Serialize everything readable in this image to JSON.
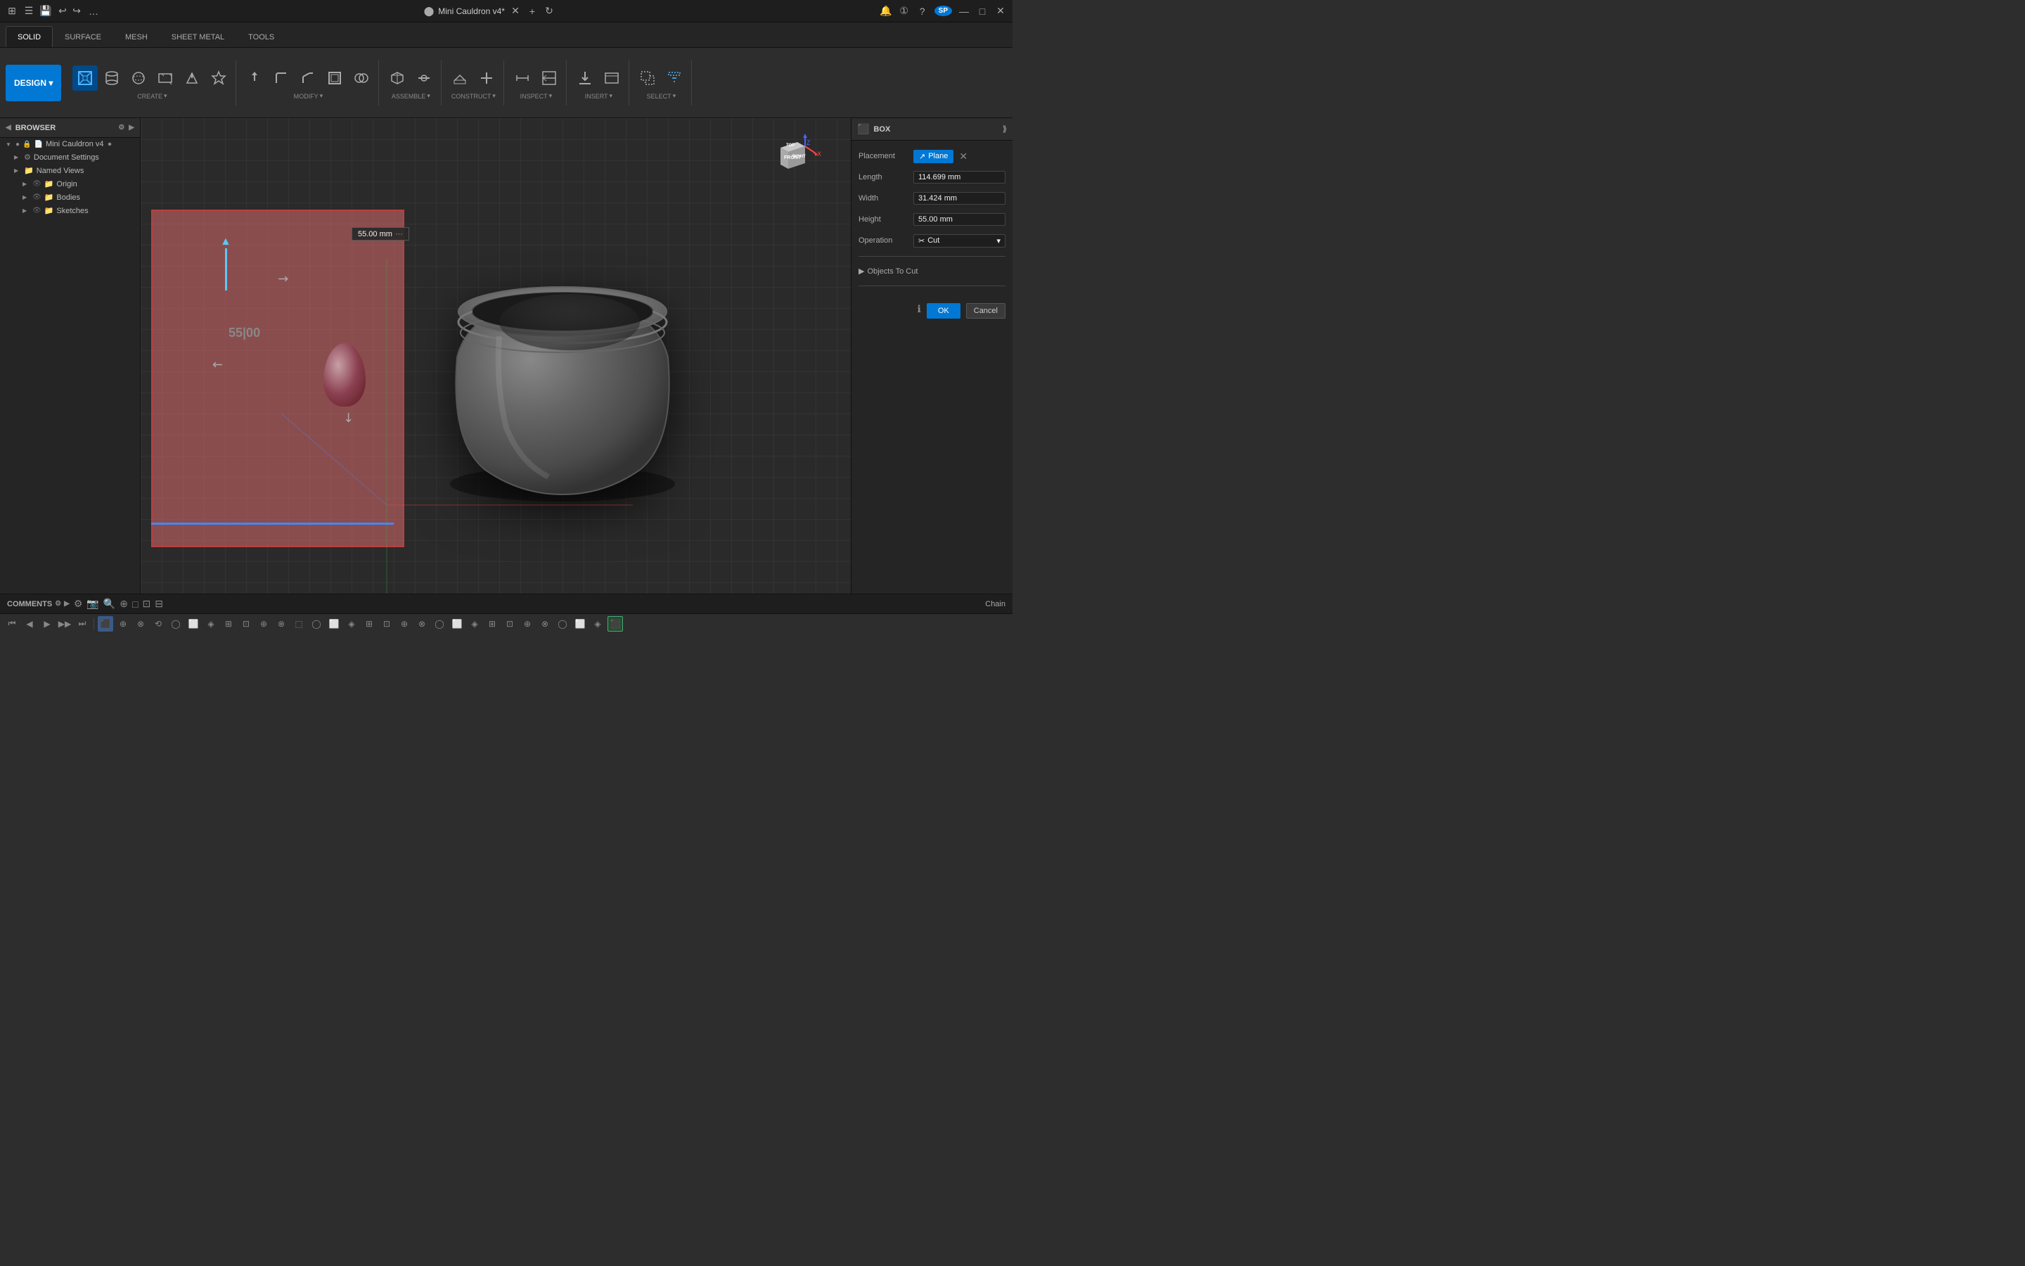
{
  "app": {
    "title": "Mini Cauldron v4*",
    "title_icon": "●"
  },
  "titlebar": {
    "logo": "⊞",
    "menu_icon": "☰",
    "save_icon": "💾",
    "undo_icon": "↩",
    "redo_icon": "↪",
    "more_icon": "…",
    "notification_label": "🔔",
    "help_icon": "?",
    "profile_label": "SP",
    "close_icon": "✕",
    "minimize_icon": "—",
    "maximize_icon": "□",
    "refresh_icon": "↻",
    "add_tab_icon": "+"
  },
  "ribbon_tabs": {
    "items": [
      {
        "id": "solid",
        "label": "SOLID",
        "active": true
      },
      {
        "id": "surface",
        "label": "SURFACE",
        "active": false
      },
      {
        "id": "mesh",
        "label": "MESH",
        "active": false
      },
      {
        "id": "sheet_metal",
        "label": "SHEET METAL",
        "active": false
      },
      {
        "id": "tools",
        "label": "TOOLS",
        "active": false
      }
    ]
  },
  "ribbon": {
    "design_btn": "DESIGN ▾",
    "groups": {
      "create": {
        "label": "CREATE",
        "label_arrow": "▾",
        "icons": [
          "⬛",
          "📦",
          "⭕",
          "⬜",
          "📐",
          "✦"
        ]
      },
      "modify": {
        "label": "MODIFY",
        "label_arrow": "▾",
        "icons": [
          "⟳",
          "✂",
          "📏",
          "🔄",
          "⟵"
        ]
      },
      "assemble": {
        "label": "ASSEMBLE",
        "label_arrow": "▾",
        "icons": [
          "⊕",
          "⊗"
        ]
      },
      "construct": {
        "label": "CONSTRUCT",
        "label_arrow": "▾",
        "icons": [
          "▦",
          "⟂"
        ]
      },
      "inspect": {
        "label": "INSPECT",
        "label_arrow": "▾",
        "icons": [
          "↔",
          "📷"
        ]
      },
      "insert": {
        "label": "INSERT",
        "label_arrow": "▾",
        "icons": [
          "⬇",
          "🖼"
        ]
      },
      "select": {
        "label": "SELECT",
        "label_arrow": "▾",
        "icons": [
          "⬚",
          "⟡"
        ]
      }
    }
  },
  "browser": {
    "title": "BROWSER",
    "items": [
      {
        "id": "root",
        "label": "Mini Cauldron v4",
        "level": 0,
        "expanded": true,
        "has_arrow": true,
        "icon": "📄"
      },
      {
        "id": "doc_settings",
        "label": "Document Settings",
        "level": 1,
        "expanded": false,
        "has_arrow": true,
        "icon": "⚙"
      },
      {
        "id": "named_views",
        "label": "Named Views",
        "level": 1,
        "expanded": false,
        "has_arrow": true,
        "icon": "📁"
      },
      {
        "id": "origin",
        "label": "Origin",
        "level": 2,
        "expanded": false,
        "has_arrow": true,
        "icon": "📁"
      },
      {
        "id": "bodies",
        "label": "Bodies",
        "level": 2,
        "expanded": false,
        "has_arrow": true,
        "icon": "📁"
      },
      {
        "id": "sketches",
        "label": "Sketches",
        "level": 2,
        "expanded": false,
        "has_arrow": true,
        "icon": "📁"
      }
    ]
  },
  "viewport": {
    "dimension_value": "55.00 mm",
    "height_label": "55|00",
    "axis_colors": {
      "x": "#ff4444",
      "y": "#44ff44",
      "z": "#4488ff"
    }
  },
  "properties": {
    "title": "BOX",
    "title_icon": "⬛",
    "expand_icon": "⟫",
    "placement_label": "Placement",
    "placement_btn": "Plane",
    "placement_plane_icon": "↗",
    "placement_x": "✕",
    "length_label": "Length",
    "length_value": "114.699 mm",
    "width_label": "Width",
    "width_value": "31.424 mm",
    "height_label": "Height",
    "height_value": "55.00 mm",
    "operation_label": "Operation",
    "operation_value": "Cut",
    "operation_icon": "✂",
    "operation_arrow": "▾",
    "objects_section": "Objects To Cut",
    "objects_arrow": "▶",
    "info_icon": "ℹ",
    "ok_btn": "OK",
    "cancel_btn": "Cancel"
  },
  "statusbar": {
    "comments_label": "COMMENTS",
    "chain_label": "Chain",
    "icons": [
      "⚙",
      "📷",
      "🔍",
      "⊕",
      "□",
      "⊡",
      "⊟"
    ]
  },
  "bottom_toolbar": {
    "nav_icons": [
      "⏮",
      "◀",
      "▶",
      "▶▶",
      "⏭"
    ],
    "tool_icons": [
      "⊕",
      "⊗",
      "⟲",
      "✦",
      "⬚",
      "◯",
      "⬜",
      "◈",
      "⊞",
      "⊡",
      "⊕",
      "⊗",
      "⬚",
      "◯",
      "⬜",
      "◈",
      "⊞",
      "⊡",
      "⊕",
      "⊗"
    ]
  }
}
